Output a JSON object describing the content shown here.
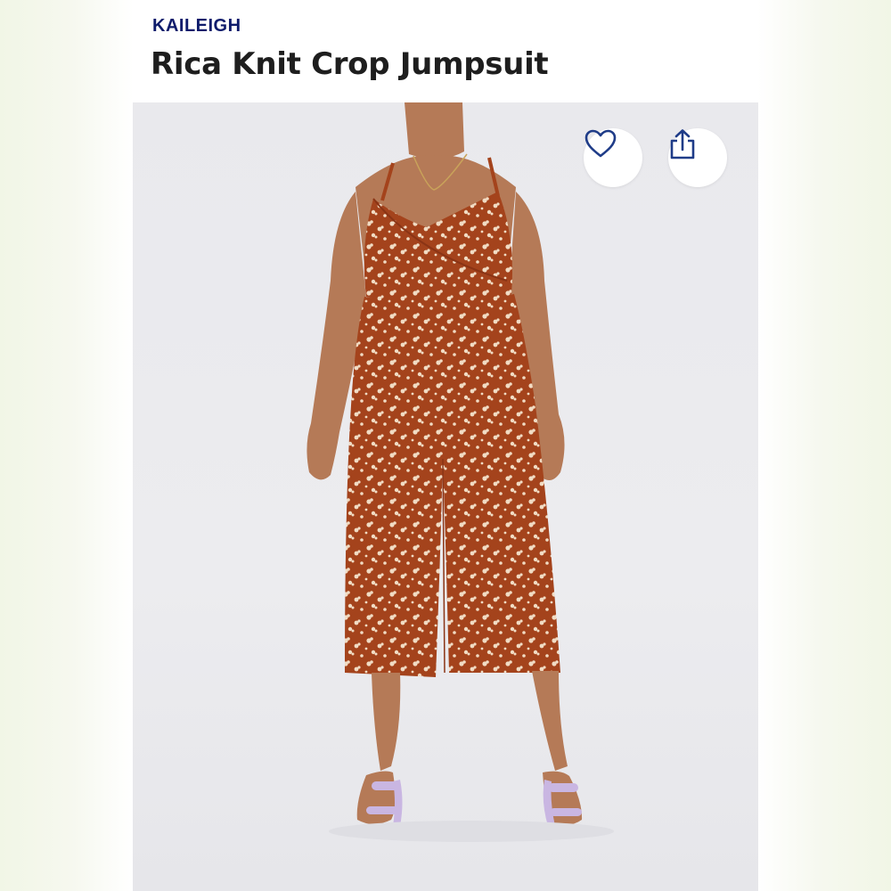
{
  "product": {
    "brand": "KAILEIGH",
    "name": "Rica Knit Crop Jumpsuit"
  },
  "actions": {
    "favorite_icon": "heart-outline-icon",
    "share_icon": "share-upload-icon"
  },
  "colors": {
    "brand_text": "#0d1b6b",
    "title_text": "#1e1e1e",
    "icon_stroke": "#1f3c88",
    "garment": "#a4431c",
    "floral_print": "#f1dcc4",
    "skin": "#b57a57",
    "sandal": "#c9b6e2"
  }
}
